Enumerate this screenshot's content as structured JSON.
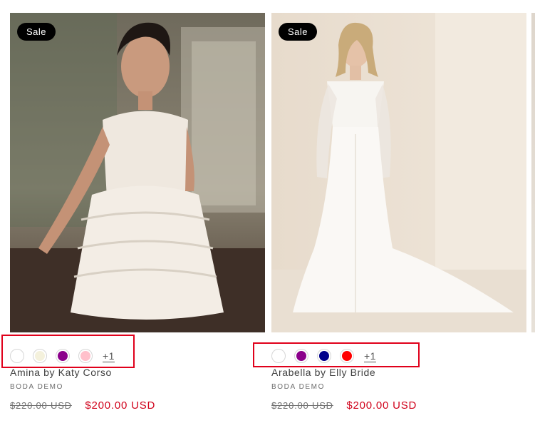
{
  "products": [
    {
      "badge": "Sale",
      "image_alt": "Woman in short white fringe halter dress",
      "swatches": [
        "#ffffff",
        "#f4f1dc",
        "#8b008b",
        "#ffc0cb"
      ],
      "more": "+1",
      "title": "Amina by Katy Corso",
      "vendor": "BODA DEMO",
      "compare_price": "$220.00 USD",
      "sale_price": "$200.00 USD"
    },
    {
      "badge": "Sale",
      "image_alt": "Woman in long-sleeve white bridal gown with train",
      "swatches": [
        "#ffffff",
        "#8b008b",
        "#00008b",
        "#ff0000"
      ],
      "more": "+1",
      "title": "Arabella by Elly Bride",
      "vendor": "BODA DEMO",
      "compare_price": "$220.00 USD",
      "sale_price": "$200.00 USD"
    }
  ],
  "colors": {
    "highlight": "#e0001b",
    "sale": "#d0021b",
    "badge_bg": "#000000"
  }
}
